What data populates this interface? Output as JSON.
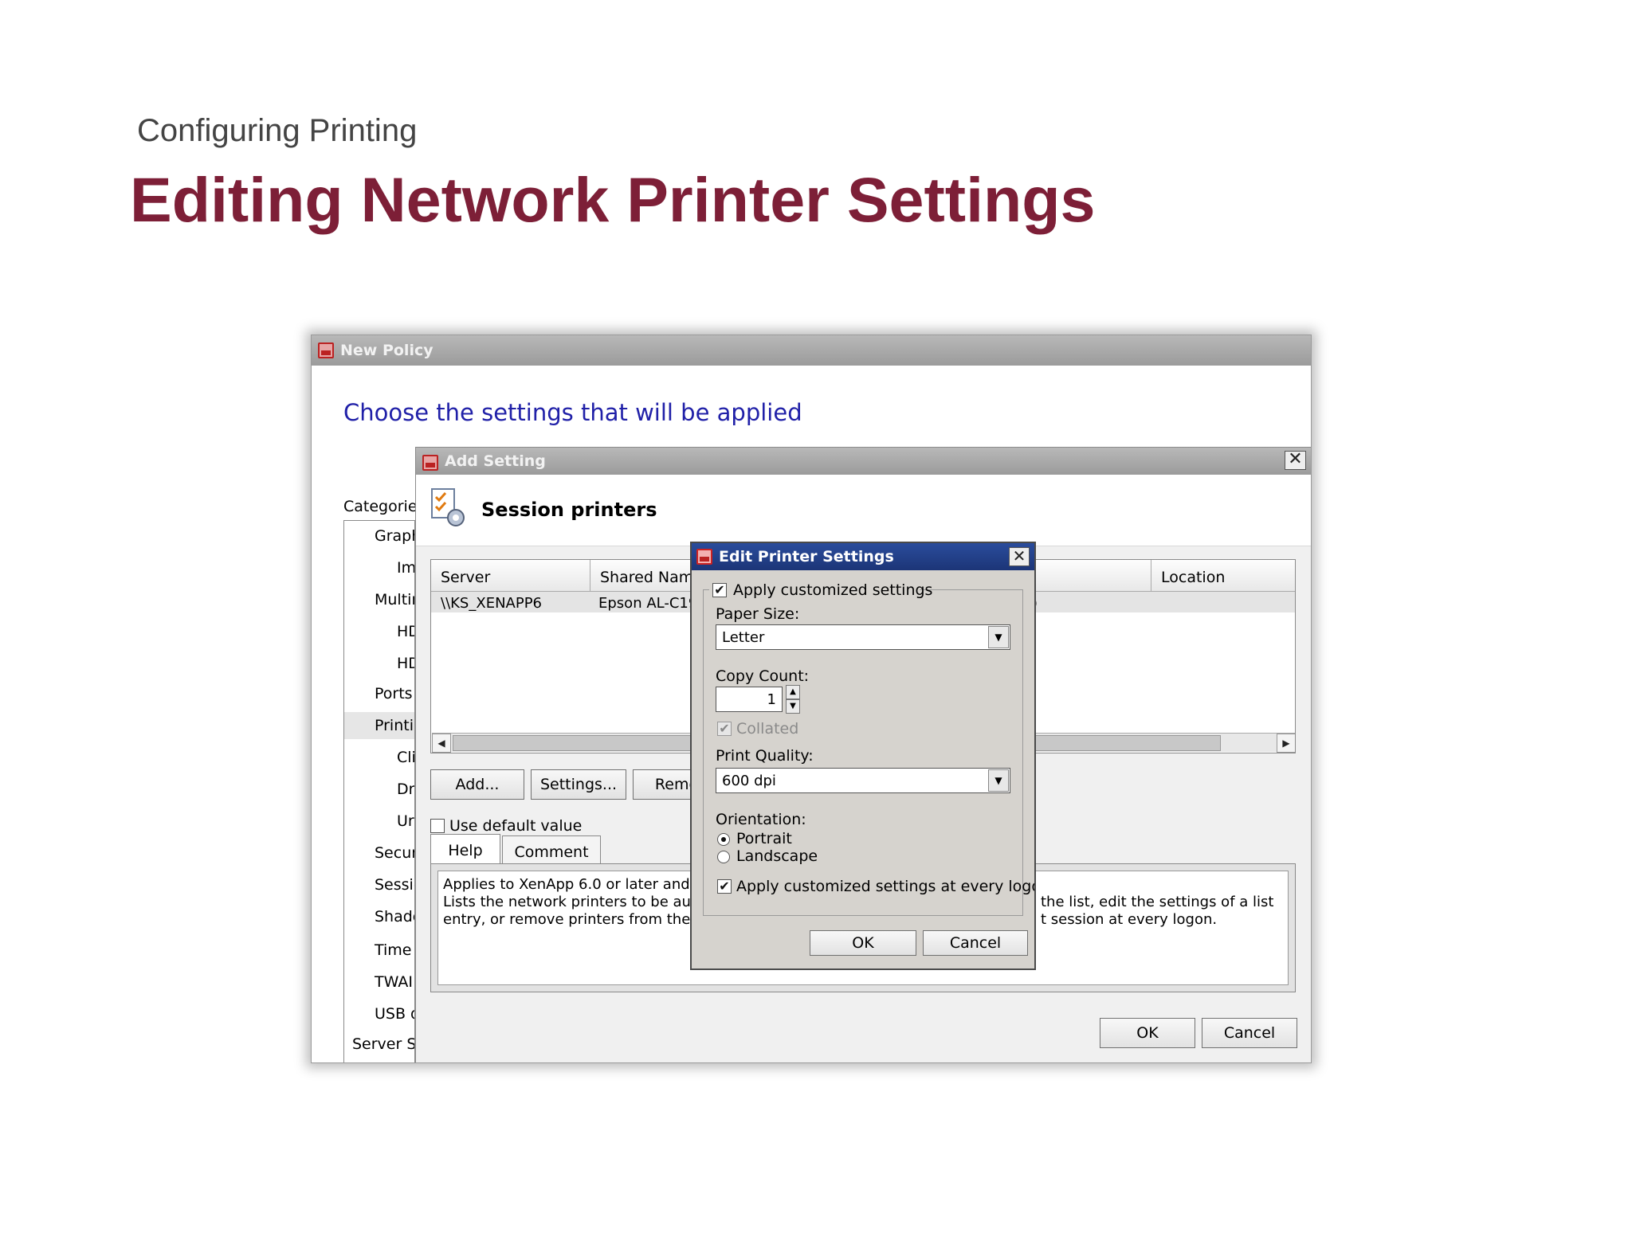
{
  "slide": {
    "subtitle": "Configuring Printing",
    "title": "Editing Network Printer Settings"
  },
  "new_policy": {
    "window_title": "New Policy",
    "heading": "Choose the settings that will be applied",
    "categories_label": "Categories",
    "categories": [
      "Graph",
      "Im",
      "Multin",
      "HD",
      "HD",
      "Ports",
      "Printir",
      "Cli",
      "Dr",
      "Ur",
      "Secur",
      "Sessic",
      "Shadc",
      "Time",
      "TWAI",
      "USB d",
      "Server Se"
    ]
  },
  "add_setting": {
    "window_title": "Add Setting",
    "close_glyph": "✕",
    "setting_title": "Session printers",
    "columns": [
      "Server",
      "Shared Name",
      "Location"
    ],
    "row": {
      "server": "\\\\KS_XENAPP6",
      "shared_name": "Epson AL-C19",
      "location_prefix": ")"
    },
    "scroll_left": "◀",
    "scroll_right": "▶",
    "buttons": {
      "add": "Add...",
      "settings": "Settings...",
      "remove": "Remo",
      "ok": "OK",
      "cancel": "Cancel"
    },
    "use_default_label": "Use default value",
    "tabs": {
      "help": "Help",
      "comment": "Comment"
    },
    "help_text": {
      "line1": "Applies to XenApp 6.0 or later and X",
      "line2": "Lists the network printers to be auto",
      "line3": "entry, or remove printers from the lis",
      "line2_right": "the list, edit the settings of a list",
      "line3_right": "t session at every logon."
    }
  },
  "edit_printer": {
    "window_title": "Edit Printer Settings",
    "close_glyph": "✕",
    "apply_customized_label": "Apply customized settings",
    "apply_customized_checked": true,
    "check_glyph": "✔",
    "paper_size_label": "Paper Size:",
    "paper_size_value": "Letter",
    "copy_count_label": "Copy Count:",
    "copy_count_value": "1",
    "spin_up": "▲",
    "spin_down": "▼",
    "collated_label": "Collated",
    "collated_checked": true,
    "print_quality_label": "Print Quality:",
    "print_quality_value": "600 dpi",
    "combo_arrow": "▼",
    "orientation_label": "Orientation:",
    "orientation_options": [
      "Portrait",
      "Landscape"
    ],
    "orientation_selected": "Portrait",
    "apply_every_logon_label": "Apply customized settings at every logon",
    "apply_every_logon_checked": true,
    "ok_label": "OK",
    "cancel_label": "Cancel",
    "title_bar_color": "#1c3577"
  }
}
